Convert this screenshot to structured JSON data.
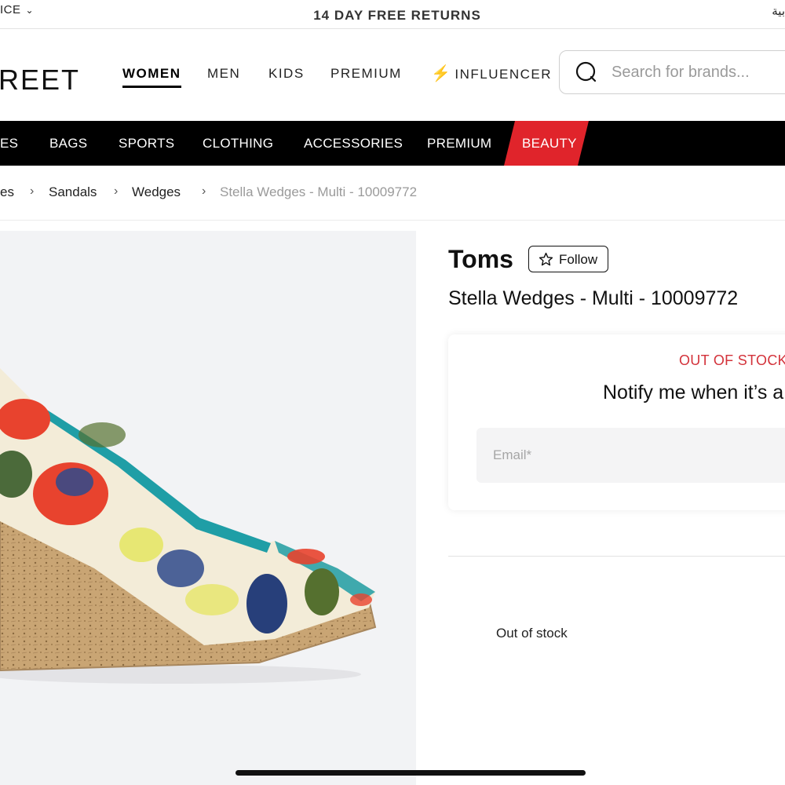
{
  "topbar": {
    "lang_selector": "ICE",
    "promo": "14 DAY FREE RETURNS",
    "arabic_link": "بية"
  },
  "header": {
    "logo": "REET",
    "nav": [
      "WOMEN",
      "MEN",
      "KIDS",
      "PREMIUM",
      "INFLUENCER"
    ],
    "active_nav": "WOMEN",
    "search_placeholder": "Search for brands..."
  },
  "categories": {
    "items": [
      "ES",
      "BAGS",
      "SPORTS",
      "CLOTHING",
      "ACCESSORIES",
      "PREMIUM",
      "BEAUTY"
    ],
    "highlight_color": "#e0242b"
  },
  "breadcrumb": {
    "items": [
      "es",
      "Sandals",
      "Wedges",
      "Stella Wedges - Multi - 10009772"
    ]
  },
  "product": {
    "brand": "Toms",
    "follow_label": "Follow",
    "name": "Stella Wedges - Multi - 10009772",
    "out_of_stock_label": "OUT OF STOCK",
    "notify_text": "Notify me when it’s a",
    "email_placeholder": "Email*",
    "stock_status": "Out of stock"
  },
  "colors": {
    "accent_red": "#d3323a",
    "category_bar": "#000000",
    "image_bg": "#f2f3f5"
  }
}
